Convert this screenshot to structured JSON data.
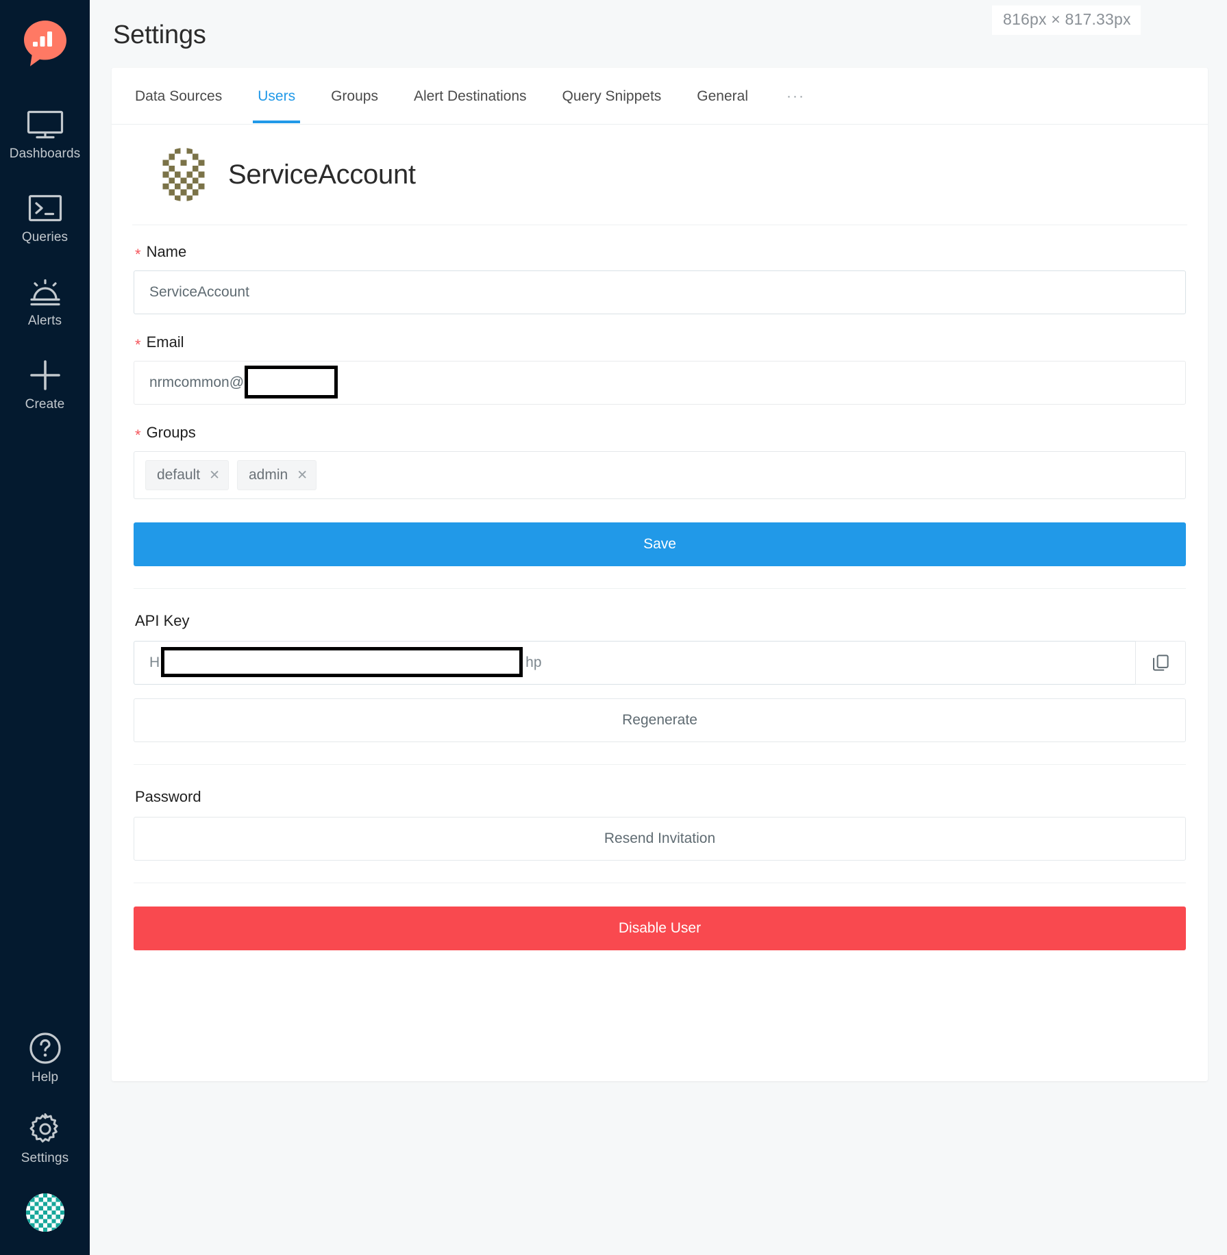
{
  "sidebar": {
    "logo_name": "redash-logo",
    "items": [
      {
        "label": "Dashboards",
        "icon": "monitor-icon",
        "name": "dashboards"
      },
      {
        "label": "Queries",
        "icon": "terminal-icon",
        "name": "queries"
      },
      {
        "label": "Alerts",
        "icon": "alarm-bell-icon",
        "name": "alerts"
      },
      {
        "label": "Create",
        "icon": "plus-icon",
        "name": "create"
      }
    ],
    "bottom_items": [
      {
        "label": "Help",
        "icon": "question-circle-icon",
        "name": "help"
      },
      {
        "label": "Settings",
        "icon": "gear-icon",
        "name": "settings"
      }
    ],
    "avatar_name": "user-avatar"
  },
  "header": {
    "title": "Settings"
  },
  "tabs": [
    {
      "label": "Data Sources",
      "active": false,
      "name": "data-sources"
    },
    {
      "label": "Users",
      "active": true,
      "name": "users"
    },
    {
      "label": "Groups",
      "active": false,
      "name": "groups"
    },
    {
      "label": "Alert Destinations",
      "active": false,
      "name": "alert-destinations"
    },
    {
      "label": "Query Snippets",
      "active": false,
      "name": "query-snippets"
    },
    {
      "label": "General",
      "active": false,
      "name": "general"
    },
    {
      "label": "···",
      "active": false,
      "name": "more"
    }
  ],
  "user": {
    "display_name": "ServiceAccount",
    "avatar_name": "profile-avatar"
  },
  "form": {
    "name_label": "Name",
    "name_value": "ServiceAccount",
    "email_label": "Email",
    "email_value_visible": "nrmcommon@",
    "email_redacted": true,
    "groups_label": "Groups",
    "groups": [
      "default",
      "admin"
    ],
    "tag_remove_glyph": "✕",
    "save_label": "Save"
  },
  "api_key": {
    "section_label": "API Key",
    "value_prefix": "H",
    "value_suffix": "hp",
    "redacted": true,
    "copy_icon": "copy-icon",
    "regenerate_label": "Regenerate"
  },
  "password": {
    "section_label": "Password",
    "resend_label": "Resend Invitation"
  },
  "danger": {
    "disable_label": "Disable User"
  },
  "overlay": {
    "size_tooltip": "816px × 817.33px"
  },
  "colors": {
    "sidebar_bg": "#041a2f",
    "accent": "#2199e8",
    "danger": "#f9494f",
    "logo": "#ff7964",
    "required": "#f5565c"
  }
}
